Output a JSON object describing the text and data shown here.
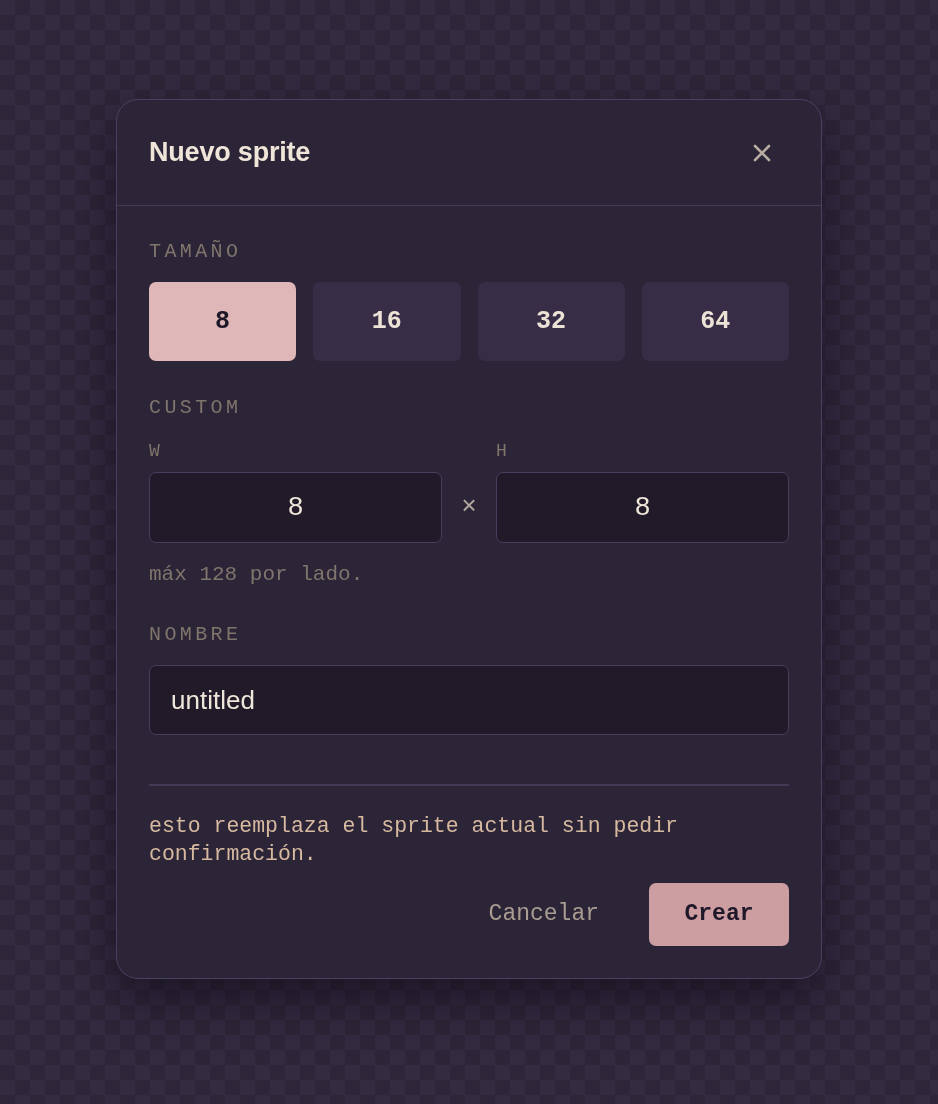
{
  "dialog": {
    "title": "Nuevo sprite"
  },
  "size": {
    "label": "TAMAÑO",
    "options": [
      {
        "label": "8",
        "selected": true
      },
      {
        "label": "16",
        "selected": false
      },
      {
        "label": "32",
        "selected": false
      },
      {
        "label": "64",
        "selected": false
      }
    ]
  },
  "custom": {
    "label": "CUSTOM",
    "fields": [
      {
        "label": "W",
        "value": "8"
      },
      {
        "label": "H",
        "value": "8"
      }
    ],
    "separator": "×",
    "hint": "máx 128 por lado."
  },
  "name": {
    "label": "NOMBRE",
    "value": "untitled"
  },
  "warning": "esto reemplaza el sprite actual sin pedir confirmación.",
  "actions": [
    {
      "label": "Cancelar",
      "kind": "ghost"
    },
    {
      "label": "Crear",
      "kind": "primary"
    }
  ]
}
